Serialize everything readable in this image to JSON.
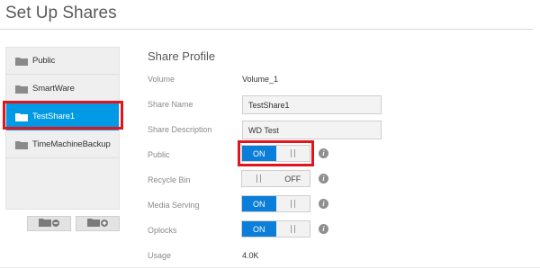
{
  "page": {
    "title": "Set Up Shares"
  },
  "sidebar": {
    "items": [
      {
        "label": "Public",
        "active": false
      },
      {
        "label": "SmartWare",
        "active": false
      },
      {
        "label": "TestShare1",
        "active": true
      },
      {
        "label": "TimeMachineBackup",
        "active": false
      }
    ],
    "buttons": [
      {
        "icon": "folder-remove-icon"
      },
      {
        "icon": "folder-add-icon"
      }
    ]
  },
  "profile": {
    "title": "Share Profile",
    "volume": {
      "label": "Volume",
      "value": "Volume_1"
    },
    "share_name": {
      "label": "Share Name",
      "value": "TestShare1"
    },
    "share_description": {
      "label": "Share Description",
      "value": "WD Test"
    },
    "public": {
      "label": "Public",
      "state": "ON"
    },
    "recycle_bin": {
      "label": "Recycle Bin",
      "state": "OFF"
    },
    "media_serving": {
      "label": "Media Serving",
      "state": "ON"
    },
    "oplocks": {
      "label": "Oplocks",
      "state": "ON"
    },
    "usage": {
      "label": "Usage",
      "value": "4.0K"
    }
  },
  "colors": {
    "accent": "#0099e5",
    "toggle_on": "#0a7ed8",
    "highlight": "#e3141b"
  }
}
